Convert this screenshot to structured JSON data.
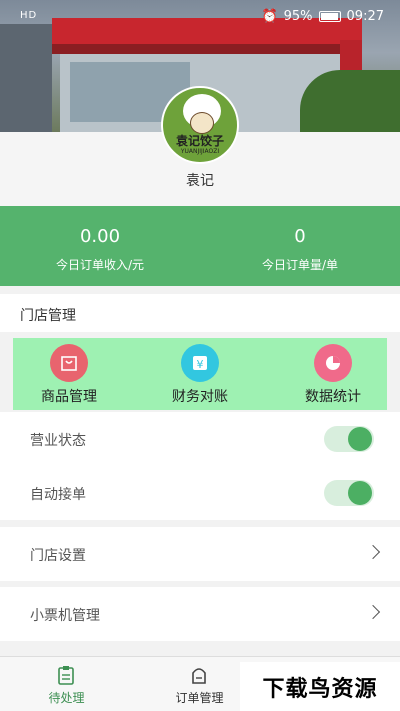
{
  "status_bar": {
    "left": "HD",
    "battery": "95%",
    "time": "09:27"
  },
  "store": {
    "logo_text": "袁记饺子",
    "logo_text_en": "YUANJIJIAOZI",
    "name": "袁记"
  },
  "stats": [
    {
      "value": "0.00",
      "label": "今日订单收入/元"
    },
    {
      "value": "0",
      "label": "今日订单量/单"
    }
  ],
  "section_title": "门店管理",
  "quick_actions": [
    {
      "label": "商品管理",
      "icon": "goods-bag-icon",
      "color": "#e8646e"
    },
    {
      "label": "财务对账",
      "icon": "yen-icon",
      "color": "#32c7e0"
    },
    {
      "label": "数据统计",
      "icon": "pie-chart-icon",
      "color": "#f06a8a"
    }
  ],
  "toggles": [
    {
      "label": "营业状态",
      "on": true
    },
    {
      "label": "自动接单",
      "on": true
    }
  ],
  "nav_rows": [
    {
      "label": "门店设置"
    },
    {
      "label": "小票机管理"
    }
  ],
  "tabs": [
    {
      "label": "待处理",
      "active": true,
      "icon": "clipboard-icon"
    },
    {
      "label": "订单管理",
      "active": false,
      "icon": "order-box-icon"
    }
  ],
  "watermark": "下载鸟资源",
  "colors": {
    "primary": "#55b36d",
    "quick_bg": "#9ef1b2",
    "toggle_on": "#4caf63"
  }
}
